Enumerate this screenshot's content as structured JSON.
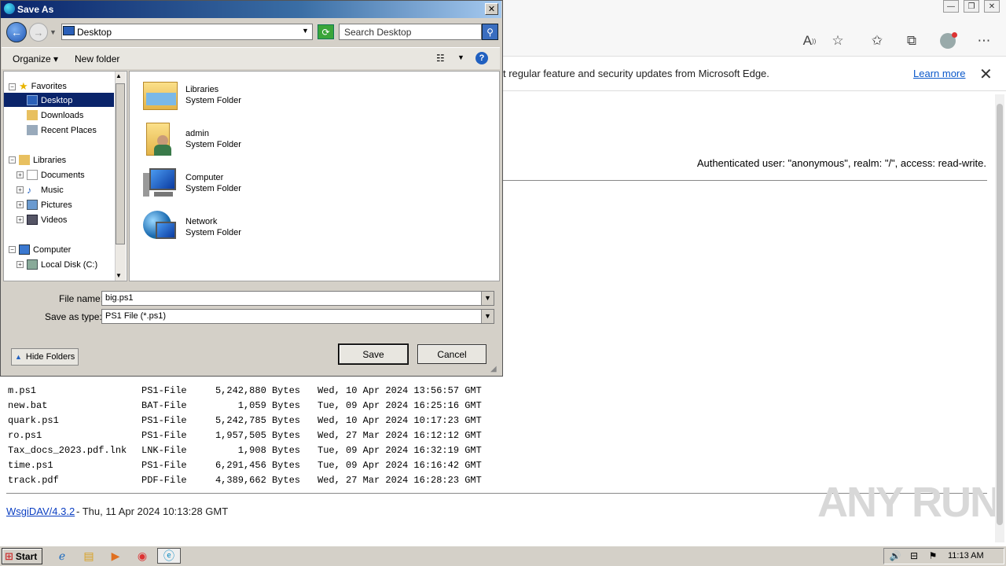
{
  "browser": {
    "window_controls": [
      "—",
      "❐",
      "✕"
    ],
    "info_bar": {
      "text": "t regular feature and security updates from Microsoft Edge.",
      "link": "Learn more"
    }
  },
  "page": {
    "auth_text": "Authenticated user: \"anonymous\", realm: \"/\", access: read-write.",
    "files": [
      {
        "name": "m.ps1",
        "type": "PS1-File",
        "size": "5,242,880 Bytes",
        "date": "Wed, 10 Apr 2024 13:56:57 GMT"
      },
      {
        "name": "new.bat",
        "type": "BAT-File",
        "size": "1,059 Bytes",
        "date": "Tue, 09 Apr 2024 16:25:16 GMT"
      },
      {
        "name": "quark.ps1",
        "type": "PS1-File",
        "size": "5,242,785 Bytes",
        "date": "Wed, 10 Apr 2024 10:17:23 GMT"
      },
      {
        "name": "ro.ps1",
        "type": "PS1-File",
        "size": "1,957,505 Bytes",
        "date": "Wed, 27 Mar 2024 16:12:12 GMT"
      },
      {
        "name": "Tax_docs_2023.pdf.lnk",
        "type": "LNK-File",
        "size": "1,908 Bytes",
        "date": "Tue, 09 Apr 2024 16:32:19 GMT"
      },
      {
        "name": "time.ps1",
        "type": "PS1-File",
        "size": "6,291,456 Bytes",
        "date": "Tue, 09 Apr 2024 16:16:42 GMT"
      },
      {
        "name": "track.pdf",
        "type": "PDF-File",
        "size": "4,389,662 Bytes",
        "date": "Wed, 27 Mar 2024 16:28:23 GMT"
      }
    ],
    "footer_link": "WsgiDAV/4.3.2",
    "footer_text": "- Thu, 11 Apr 2024 10:13:28 GMT",
    "watermark": "ANY RUN"
  },
  "dialog": {
    "title": "Save As",
    "path": "Desktop",
    "search_placeholder": "Search Desktop",
    "organize": "Organize",
    "new_folder": "New folder",
    "tree": [
      {
        "label": "Favorites",
        "level": 0
      },
      {
        "label": "Desktop",
        "level": 1
      },
      {
        "label": "Downloads",
        "level": 1
      },
      {
        "label": "Recent Places",
        "level": 1
      },
      {
        "label": "Libraries",
        "level": 0
      },
      {
        "label": "Documents",
        "level": 1
      },
      {
        "label": "Music",
        "level": 1
      },
      {
        "label": "Pictures",
        "level": 1
      },
      {
        "label": "Videos",
        "level": 1
      },
      {
        "label": "Computer",
        "level": 0
      },
      {
        "label": "Local Disk (C:)",
        "level": 1
      }
    ],
    "items": [
      {
        "name": "Libraries",
        "type": "System Folder"
      },
      {
        "name": "admin",
        "type": "System Folder"
      },
      {
        "name": "Computer",
        "type": "System Folder"
      },
      {
        "name": "Network",
        "type": "System Folder"
      }
    ],
    "file_name_label": "File name:",
    "file_name_value": "big.ps1",
    "save_type_label": "Save as type:",
    "save_type_value": "PS1 File (*.ps1)",
    "hide_folders": "Hide Folders",
    "save": "Save",
    "cancel": "Cancel"
  },
  "taskbar": {
    "start": "Start",
    "clock": "11:13 AM"
  }
}
